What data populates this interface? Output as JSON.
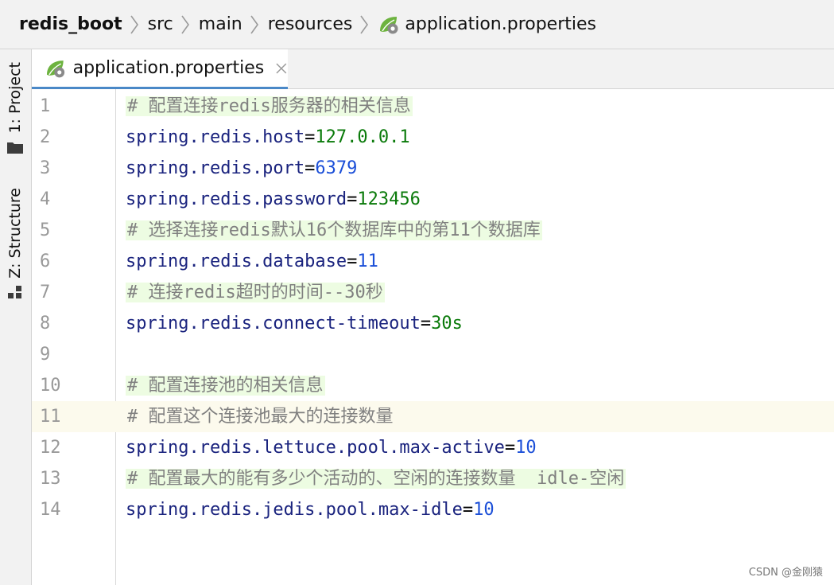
{
  "breadcrumb": {
    "items": [
      "redis_boot",
      "src",
      "main",
      "resources",
      "application.properties"
    ],
    "file_icon": "spring-properties-icon"
  },
  "tool_strip": {
    "project_label": "1: Project",
    "project_icon": "folder-icon",
    "structure_label": "Z: Structure",
    "structure_icon": "structure-icon"
  },
  "tabs": [
    {
      "label": "application.properties",
      "icon": "spring-properties-icon",
      "close_icon": "close-icon",
      "active": true
    }
  ],
  "editor": {
    "current_line": 11,
    "lines": [
      {
        "num": "1",
        "comment": "# 配置连接redis服务器的相关信息"
      },
      {
        "num": "2",
        "key": "spring.redis.host",
        "eq": "=",
        "value": "127.0.0.1",
        "value_type": "string"
      },
      {
        "num": "3",
        "key": "spring.redis.port",
        "eq": "=",
        "value": "6379",
        "value_type": "number"
      },
      {
        "num": "4",
        "key": "spring.redis.password",
        "eq": "=",
        "value": "123456",
        "value_type": "string"
      },
      {
        "num": "5",
        "comment": "# 选择连接redis默认16个数据库中的第11个数据库"
      },
      {
        "num": "6",
        "key": "spring.redis.database",
        "eq": "=",
        "value": "11",
        "value_type": "number"
      },
      {
        "num": "7",
        "comment": "# 连接redis超时的时间--30秒"
      },
      {
        "num": "8",
        "key": "spring.redis.connect-timeout",
        "eq": "=",
        "value": "30s",
        "value_type": "string"
      },
      {
        "num": "9"
      },
      {
        "num": "10",
        "comment": "# 配置连接池的相关信息"
      },
      {
        "num": "11",
        "comment": "# 配置这个连接池最大的连接数量",
        "plain_comment": true
      },
      {
        "num": "12",
        "key": "spring.redis.lettuce.pool.max-active",
        "eq": "=",
        "value": "10",
        "value_type": "number"
      },
      {
        "num": "13",
        "comment": "# 配置最大的能有多少个活动的、空闲的连接数量  idle-空闲"
      },
      {
        "num": "14",
        "key": "spring.redis.jedis.pool.max-idle",
        "eq": "=",
        "value": "10",
        "value_type": "number"
      }
    ]
  },
  "watermark": "CSDN @金刚猿",
  "colors": {
    "comment": "#808080",
    "comment_bg": "#edfce2",
    "key": "#1a237e",
    "string_value": "#0a7a0a",
    "number_value": "#1b4fd8",
    "current_line_bg": "#fcfaed",
    "tab_underline": "#4a88c7"
  }
}
